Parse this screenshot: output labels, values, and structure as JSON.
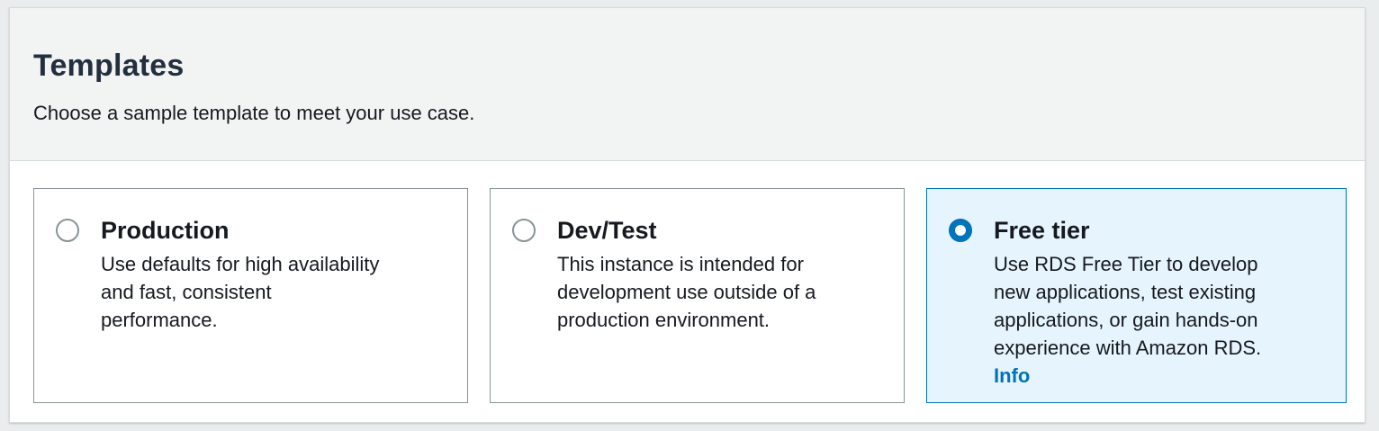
{
  "section": {
    "title": "Templates",
    "description": "Choose a sample template to meet your use case."
  },
  "options": [
    {
      "label": "Production",
      "description": "Use defaults for high availability\nand fast, consistent\nperformance.",
      "selected": false
    },
    {
      "label": "Dev/Test",
      "description": "This instance is intended for\ndevelopment use outside of a\nproduction environment.",
      "selected": false
    },
    {
      "label": "Free tier",
      "description": "Use RDS Free Tier to develop\nnew applications, test existing\napplications, or gain hands-on\nexperience with Amazon RDS.",
      "selected": true,
      "link": "Info"
    }
  ],
  "colors": {
    "accent": "#0073bb",
    "selected_bg": "#e6f4fd",
    "border": "#879596",
    "header_bg": "#f2f3f3"
  }
}
